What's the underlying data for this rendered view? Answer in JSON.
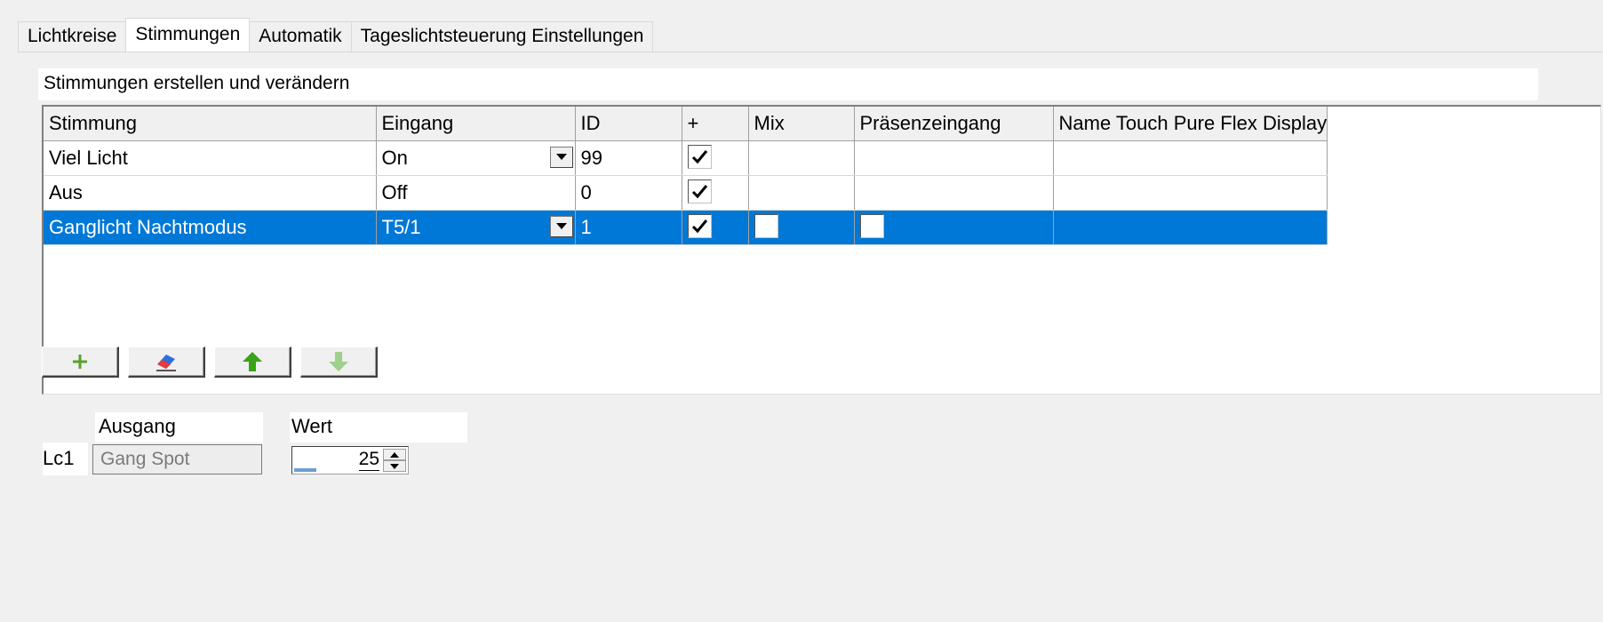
{
  "tabs": [
    {
      "label": "Lichtkreise",
      "active": false
    },
    {
      "label": "Stimmungen",
      "active": true
    },
    {
      "label": "Automatik",
      "active": false
    },
    {
      "label": "Tageslichtsteuerung Einstellungen",
      "active": false
    }
  ],
  "section_title": "Stimmungen erstellen und verändern",
  "grid": {
    "columns": [
      "Stimmung",
      "Eingang",
      "ID",
      "+",
      "Mix",
      "Präsenzeingang",
      "Name Touch Pure Flex Display"
    ],
    "rows": [
      {
        "stimmung": "Viel Licht",
        "eingang": "On",
        "id": "99",
        "plus_checked": true,
        "mix": null,
        "praesenz": null,
        "name": "",
        "selected": false
      },
      {
        "stimmung": "Aus",
        "eingang": "Off",
        "id": "0",
        "plus_checked": true,
        "mix": null,
        "praesenz": null,
        "name": "",
        "selected": false
      },
      {
        "stimmung": "Ganglicht Nachtmodus",
        "eingang": "T5/1",
        "id": "1",
        "plus_checked": true,
        "mix": false,
        "praesenz": false,
        "name": "",
        "selected": true
      }
    ]
  },
  "toolbar": {
    "add": "plus-icon",
    "delete": "eraser-icon",
    "up": "arrow-up-icon",
    "down": "arrow-down-icon"
  },
  "output": {
    "ausgang_label": "Ausgang",
    "wert_label": "Wert",
    "rows": [
      {
        "lc": "Lc1",
        "ausgang": "Gang Spot",
        "wert": "25",
        "wert_fraction": 0.25
      }
    ]
  },
  "colors": {
    "selection": "#0078d7",
    "add_green": "#5aa02c",
    "up_green": "#3aa317",
    "down_green_disabled": "#9fd08c"
  }
}
